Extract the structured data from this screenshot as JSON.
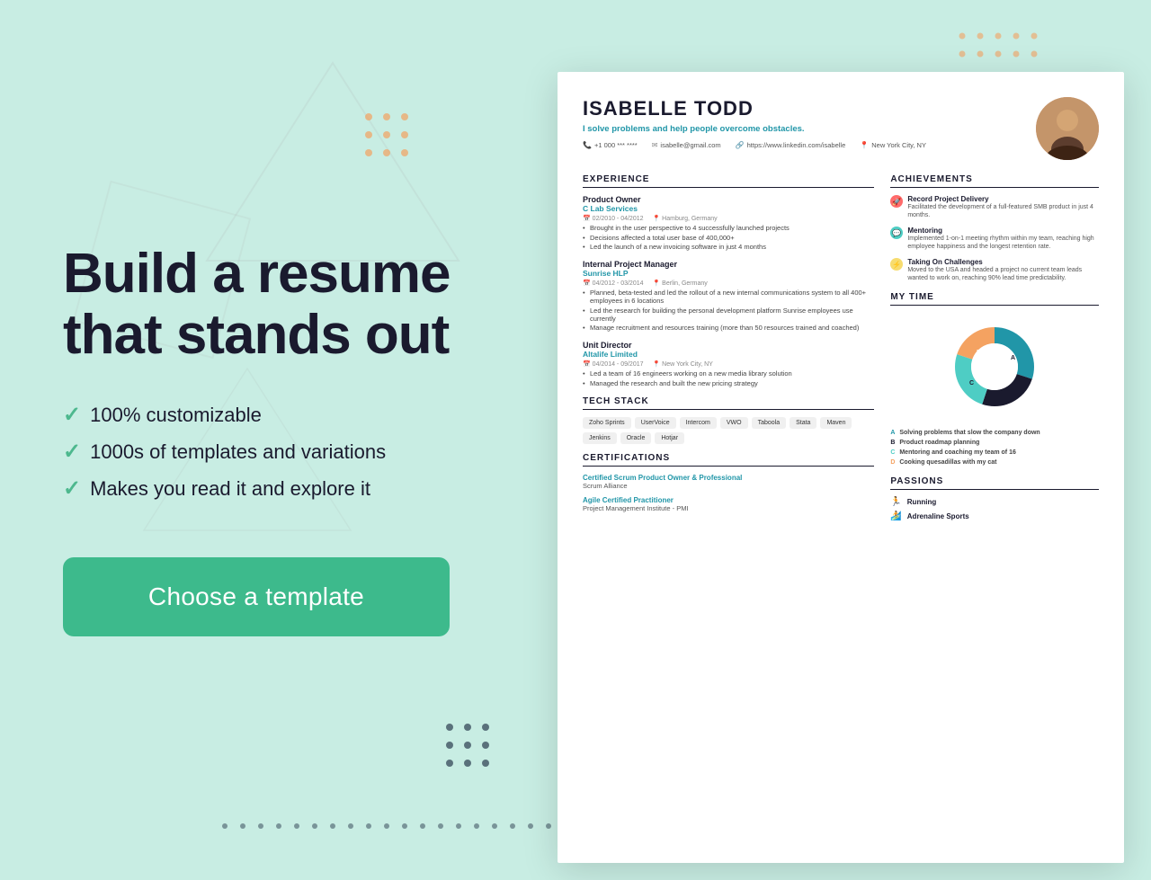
{
  "page": {
    "background_color": "#c8ede3"
  },
  "left": {
    "headline_line1": "Build a resume",
    "headline_line2": "that stands out",
    "features": [
      "100% customizable",
      "1000s of templates and variations",
      "Makes you read it and explore it"
    ],
    "cta_label": "Choose a template"
  },
  "resume": {
    "name": "ISABELLE TODD",
    "tagline": "I solve problems and help people overcome obstacles.",
    "phone": "+1 000 *** ****",
    "website": "https://www.linkedin.com/isabelle",
    "email": "isabelle@gmail.com",
    "location": "New York City, NY",
    "experience_title": "EXPERIENCE",
    "jobs": [
      {
        "title": "Product Owner",
        "company": "C Lab Services",
        "dates": "02/2010 - 04/2012",
        "location": "Hamburg, Germany",
        "bullets": [
          "Brought in the user perspective to 4 successfully launched projects",
          "Decisions affected a total user base of 400,000+",
          "Led the launch of a new invoicing software in just 4 months"
        ]
      },
      {
        "title": "Internal Project Manager",
        "company": "Sunrise HLP",
        "dates": "04/2012 - 03/2014",
        "location": "Berlin, Germany",
        "bullets": [
          "Planned, beta-tested and led the rollout of a new internal communications system to all 400+ employees in 6 locations",
          "Led the research for building the personal development platform Sunrise employees use currently",
          "Manage recruitment and resources training (more than 50 resources trained and coached)"
        ]
      },
      {
        "title": "Unit Director",
        "company": "Altalife Limited",
        "dates": "04/2014 - 09/2017",
        "location": "New York City, NY",
        "bullets": [
          "Led a team of 16 engineers working on a new media library solution",
          "Managed the research and built the new pricing strategy"
        ]
      }
    ],
    "tech_stack_title": "TECH STACK",
    "tech_stack": [
      "Zoho Sprints",
      "UserVoice",
      "Intercom",
      "VWO",
      "Taboola",
      "Stata",
      "Maven",
      "Jenkins",
      "Oracle",
      "Hotjar"
    ],
    "certifications_title": "CERTIFICATIONS",
    "certifications": [
      {
        "name": "Certified Scrum Product Owner & Professional",
        "org": "Scrum Alliance"
      },
      {
        "name": "Agile Certified Practitioner",
        "org": "Project Management Institute - PMI"
      }
    ],
    "achievements_title": "ACHIEVEMENTS",
    "achievements": [
      {
        "icon": "🚀",
        "icon_type": "rocket",
        "title": "Record Project Delivery",
        "desc": "Facilitated the development of a full-featured SMB product in just 4 months."
      },
      {
        "icon": "💬",
        "icon_type": "chat",
        "title": "Mentoring",
        "desc": "Implemented 1-on-1 meeting rhythm within my team, reaching high employee happiness and the longest retention rate."
      },
      {
        "icon": "⚡",
        "icon_type": "bolt",
        "title": "Taking On Challenges",
        "desc": "Moved to the USA and headed a project no current team leads wanted to work on, reaching 90% lead time predictability."
      }
    ],
    "my_time_title": "MY TIME",
    "time_segments": [
      {
        "label": "A",
        "value": 30,
        "color": "#2196a8",
        "desc": "Solving problems that slow the company down"
      },
      {
        "label": "B",
        "value": 25,
        "color": "#1a1a2e",
        "desc": "Product roadmap planning"
      },
      {
        "label": "C",
        "value": 25,
        "color": "#4ecdc4",
        "desc": "Mentoring and coaching my team of 16"
      },
      {
        "label": "D",
        "value": 20,
        "color": "#f4a261",
        "desc": "Cooking quesadillas with my cat"
      }
    ],
    "passions_title": "PASSIONS",
    "passions": [
      "Running",
      "Adrenaline Sports"
    ]
  }
}
